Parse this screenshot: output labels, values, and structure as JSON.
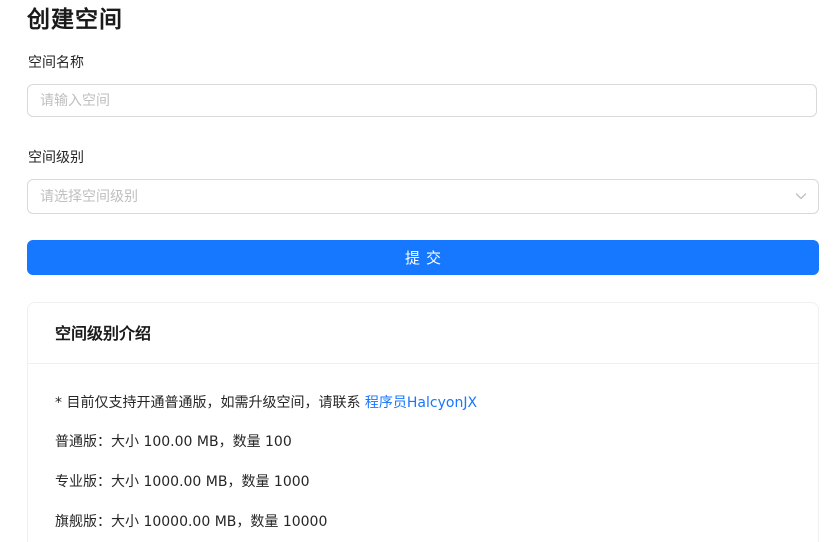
{
  "page": {
    "title": "创建空间"
  },
  "form": {
    "name_label": "空间名称",
    "name_placeholder": "请输入空间",
    "name_value": "",
    "level_label": "空间级别",
    "level_placeholder": "请选择空间级别",
    "submit_label": "提交"
  },
  "levels_card": {
    "title": "空间级别介绍",
    "note_prefix": "* 目前仅支持开通普通版，如需升级空间，请联系 ",
    "contact_link": "程序员HalcyonJX",
    "levels": [
      {
        "text": "普通版：大小 100.00 MB，数量 100"
      },
      {
        "text": "专业版：大小 1000.00 MB，数量 1000"
      },
      {
        "text": "旗舰版：大小 10000.00 MB，数量 10000"
      }
    ]
  },
  "colors": {
    "primary": "#1677ff",
    "border": "#d9d9d9",
    "placeholder": "#bfbfbf"
  },
  "icons": {
    "select_arrow": "chevron-down-icon"
  }
}
